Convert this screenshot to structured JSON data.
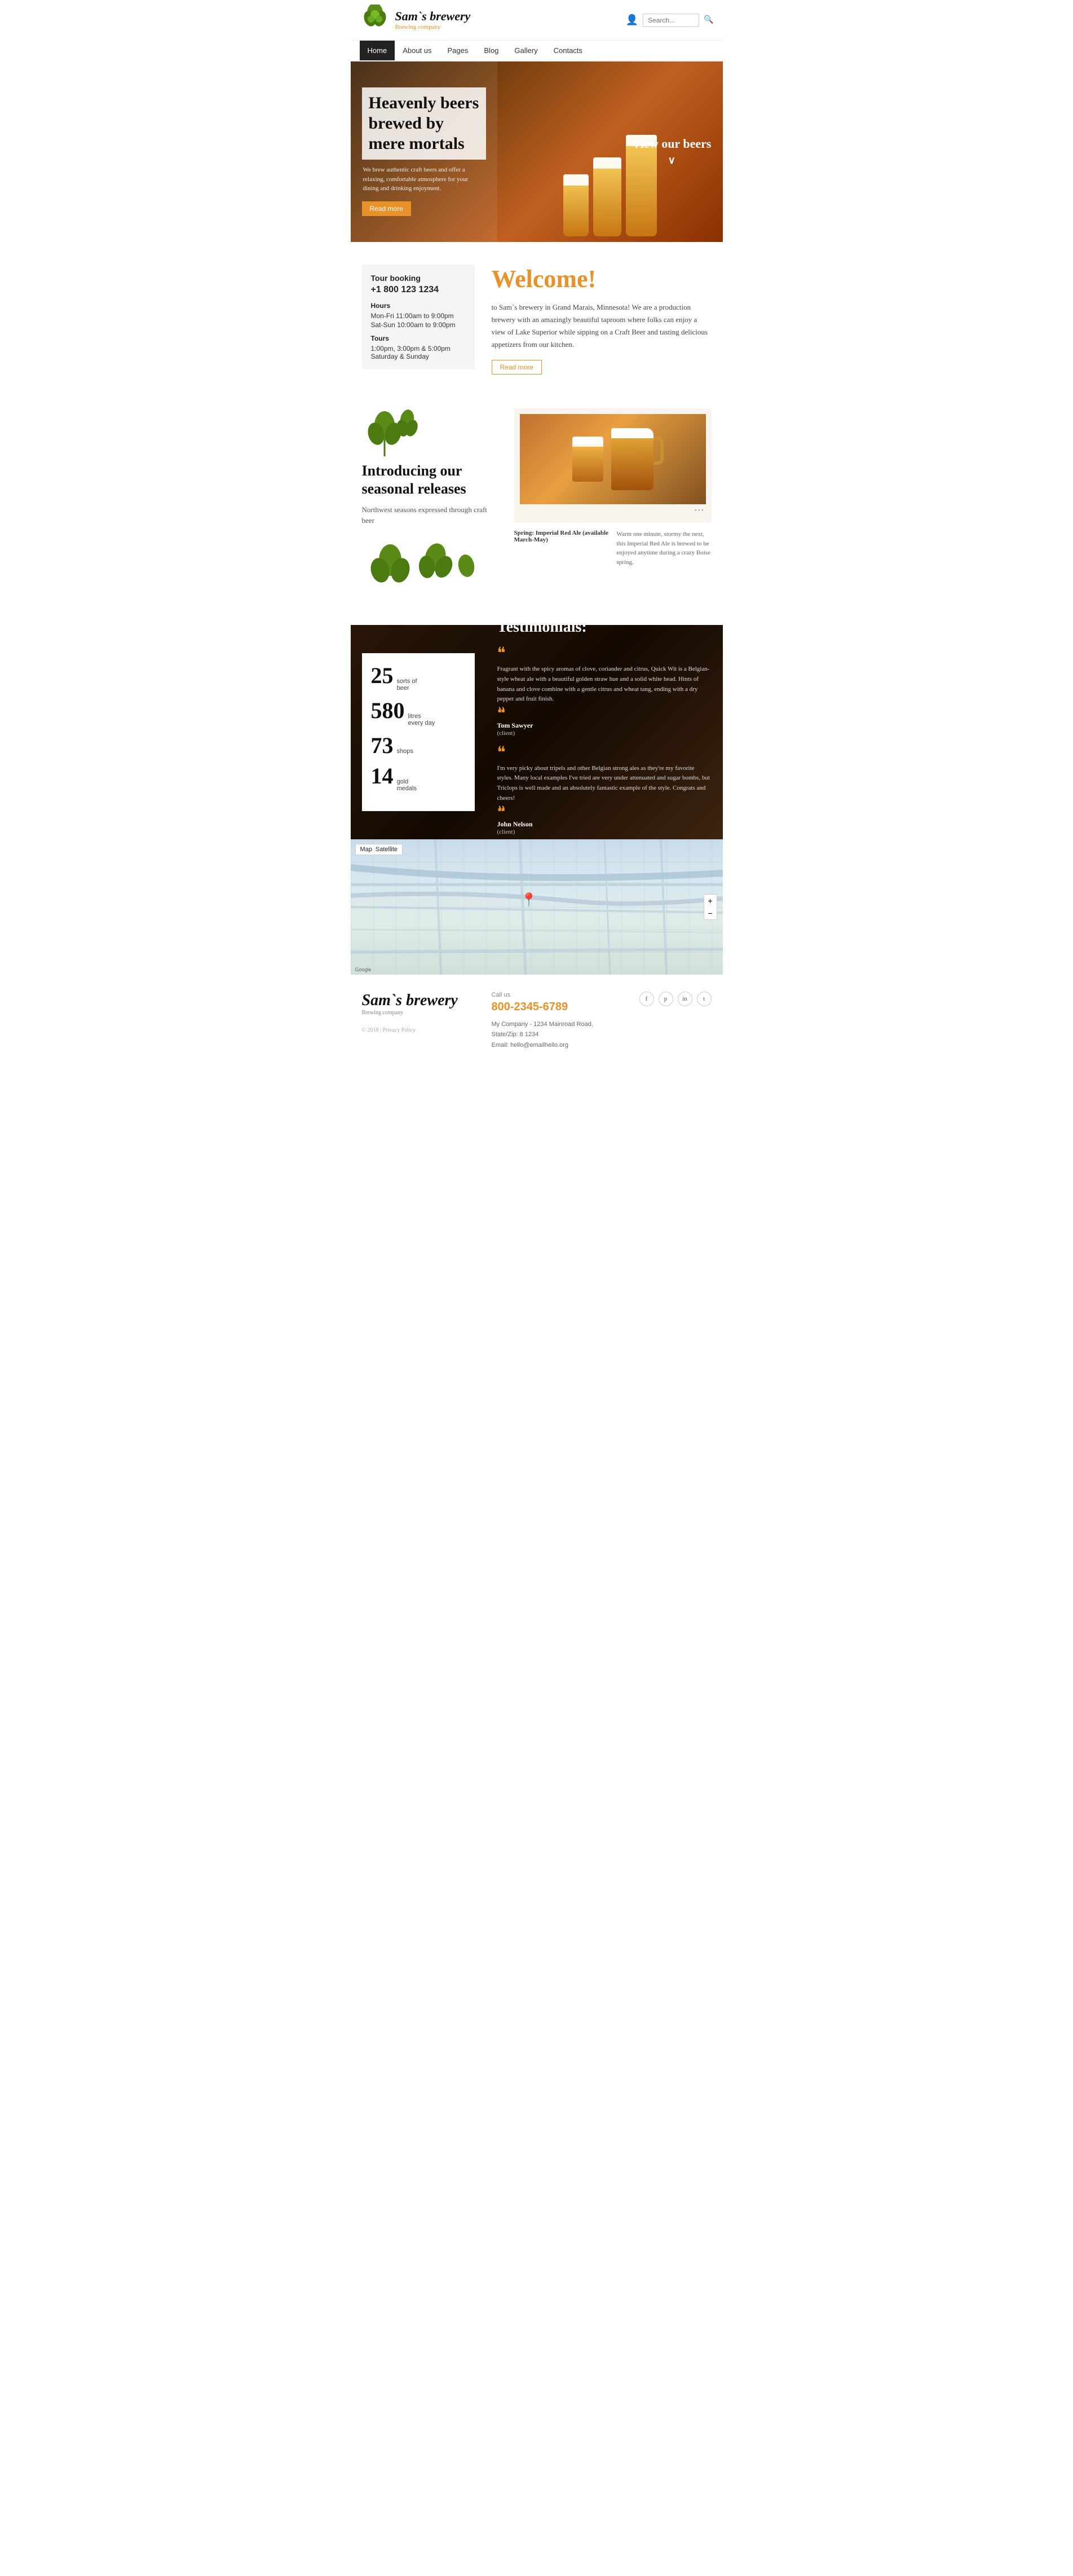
{
  "site": {
    "brand": "Sam`s brewery",
    "tagline": "Brewing company",
    "logo_alt": "Sam's Brewery Logo"
  },
  "header": {
    "search_placeholder": "Search...",
    "user_icon": "👤",
    "search_icon": "🔍"
  },
  "nav": {
    "items": [
      {
        "label": "Home",
        "active": true
      },
      {
        "label": "About us",
        "active": false
      },
      {
        "label": "Pages",
        "active": false
      },
      {
        "label": "Blog",
        "active": false
      },
      {
        "label": "Gallery",
        "active": false
      },
      {
        "label": "Contacts",
        "active": false
      }
    ]
  },
  "hero": {
    "title": "Heavenly beers brewed by mere mortals",
    "description": "We brew authentic craft beers and offer a relaxing, comfortable atmosphere for your dining and drinking enjoyment.",
    "read_more": "Read more",
    "view_beers": "View our beers",
    "arrow": "∨"
  },
  "tour": {
    "title": "Tour booking",
    "phone": "+1 800 123 1234",
    "hours_title": "Hours",
    "hours_weekday": "Mon-Fri 11:00am to 9:00pm",
    "hours_weekend": "Sat-Sun 10:00am to 9:00pm",
    "tours_title": "Tours",
    "tours_time": "1:00pm, 3:00pm & 5:00pm",
    "tours_days": "Saturday & Sunday"
  },
  "welcome": {
    "heading": "Welcome!",
    "text": "to Sam`s brewery in Grand Marais, Minnesota! We are a production brewery with an amazingly beautiful taproom where folks can enjoy a view of Lake Superior while sipping on a Craft Beer and tasting delicious appetizers from our kitchen.",
    "read_more": "Read more"
  },
  "seasonal": {
    "title": "Introducing our seasonal releases",
    "subtitle": "Northwest seasons expressed through craft beer",
    "beer_name": "Spring: Imperial Red Ale (available March-May)",
    "beer_desc": "Warm one minute, stormy the next, this Imperial Red Ale is brewed to be enjoyed anytime during a crazy Boise spring.",
    "carousel_dots": "• • •"
  },
  "stats": [
    {
      "number": "25",
      "label": "sorts of",
      "label2": "beer"
    },
    {
      "number": "580",
      "label": "litres",
      "label2": "every day"
    },
    {
      "number": "73",
      "label": "shops",
      "label2": ""
    },
    {
      "number": "14",
      "label": "gold",
      "label2": "medals"
    }
  ],
  "testimonials": {
    "heading": "Testimonials:",
    "items": [
      {
        "text": "Fragrant with the spicy aromas of clove, coriander and citrus, Quick Wit is a Belgian-style wheat ale with a beautiful golden straw hue and a solid white head. Hints of banana and clove combine with a gentle citrus and wheat tang, ending with a dry pepper and fruit finish.",
        "author": "Tom Sawyer",
        "role": "(client)"
      },
      {
        "text": "I'm very picky about tripels and other Belgian strong ales as they're my favorite styles. Many local examples I've tried are very under attenuated and sugar bombs, but Triclops is well made and an absolutely fantastic example of the style. Congrats and cheers!",
        "author": "John Nelson",
        "role": "(client)"
      }
    ]
  },
  "map": {
    "controls": [
      "Map",
      "Satellite"
    ],
    "google_label": "Google"
  },
  "footer": {
    "brand": "Sam`s brewery",
    "tagline": "Brewing company",
    "copyright": "© 2018 | Privacy Policy",
    "call_label": "Call us",
    "phone": "800-2345-6789",
    "address_line1": "My Company - 1234 Mainroad Road,",
    "address_line2": "State/Zip: 8 1234",
    "email": "Email: hello@emailhello.org",
    "social": [
      "f",
      "p",
      "in",
      "t"
    ]
  }
}
